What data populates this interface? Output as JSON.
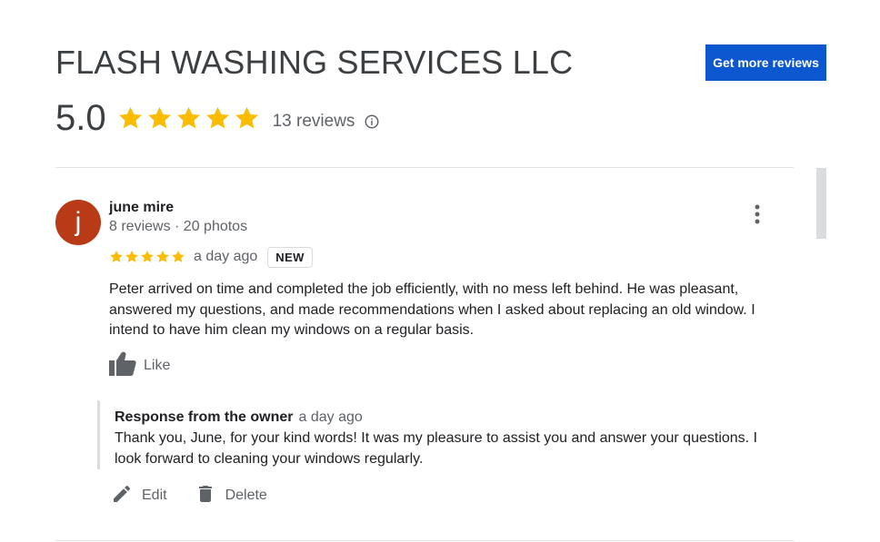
{
  "header": {
    "business_name": "FLASH WASHING SERVICES LLC",
    "get_more_reviews_label": "Get more reviews",
    "rating_value": "5.0",
    "star_count": 5,
    "review_count_text": "13 reviews"
  },
  "review": {
    "avatar_letter": "j",
    "avatar_color": "#b83a16",
    "reviewer_name": "june mire",
    "reviewer_meta": "8 reviews · 20 photos",
    "rating": 5,
    "time": "a day ago",
    "badge": "NEW",
    "text": "Peter arrived on time and completed the job efficiently, with no mess left behind. He was pleasant, answered my questions, and made recommendations when I asked about replacing an old window. I intend to have him clean my windows on a regular basis.",
    "like_label": "Like"
  },
  "owner_response": {
    "title": "Response from the owner",
    "time": "a day ago",
    "text": "Thank you, June, for your kind words! It was my pleasure to assist you and answer your questions. I look forward to cleaning your windows regularly."
  },
  "actions": {
    "edit_label": "Edit",
    "delete_label": "Delete"
  },
  "colors": {
    "star": "#fbbc04",
    "button": "#0b57d0",
    "icon": "#5f6368"
  },
  "icons": {
    "info": "info-icon",
    "more": "more-vert-icon",
    "like": "thumb-up-icon",
    "edit": "pencil-icon",
    "delete": "trash-icon"
  }
}
